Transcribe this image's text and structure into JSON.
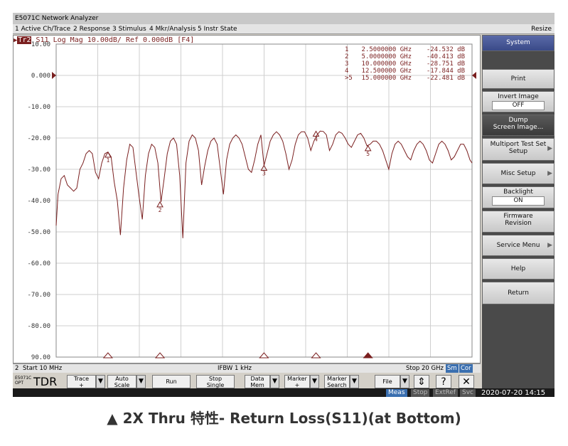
{
  "window": {
    "title": "E5071C Network Analyzer",
    "resize": "Resize"
  },
  "menu": [
    {
      "label": "1 Active Ch/Trace"
    },
    {
      "label": "2 Response"
    },
    {
      "label": "3 Stimulus"
    },
    {
      "label": "4 Mkr/Analysis"
    },
    {
      "label": "5 Instr State"
    }
  ],
  "trace": {
    "tag": "Tr2",
    "header": "S11  Log Mag 10.00dB/ Ref 0.000dB [F4]",
    "color": "#7a1f1f"
  },
  "chart_data": {
    "type": "line",
    "ylim": [
      -90,
      10
    ],
    "xlim": [
      0.01,
      20
    ],
    "x_unit": "GHz",
    "y_unit": "dB",
    "yticks": [
      "10.00",
      "0.000",
      "-10.00",
      "-20.00",
      "-30.00",
      "-40.00",
      "-50.00",
      "-60.00",
      "-70.00",
      "-80.00",
      "90.00"
    ],
    "grid": true,
    "markers": [
      {
        "id": "1",
        "freq": "2.5000000 GHz",
        "value": "-24.532 dB",
        "x": 2.5,
        "y": -24.532
      },
      {
        "id": "2",
        "freq": "5.0000000 GHz",
        "value": "-40.413 dB",
        "x": 5.0,
        "y": -40.413
      },
      {
        "id": "3",
        "freq": "10.000000 GHz",
        "value": "-28.751 dB",
        "x": 10.0,
        "y": -28.751
      },
      {
        "id": "4",
        "freq": "12.500000 GHz",
        "value": "-17.844 dB",
        "x": 12.5,
        "y": -17.844
      },
      {
        "id": "5",
        "freq": "15.000000 GHz",
        "value": "-22.481 dB",
        "x": 15.0,
        "y": -22.481,
        "active": true
      }
    ],
    "series": [
      {
        "x": [
          0.01,
          0.1,
          0.25,
          0.4,
          0.55,
          0.7,
          0.85,
          1.0,
          1.15,
          1.3,
          1.45,
          1.6,
          1.75,
          1.9,
          2.05,
          2.2,
          2.35,
          2.5,
          2.65,
          2.8,
          2.95,
          3.1,
          3.25,
          3.4,
          3.55,
          3.7,
          3.85,
          4.0,
          4.15,
          4.3,
          4.45,
          4.6,
          4.75,
          4.9,
          5.05,
          5.2,
          5.35,
          5.5,
          5.65,
          5.8,
          5.95,
          6.1,
          6.25,
          6.4,
          6.55,
          6.7,
          6.85,
          7.0,
          7.15,
          7.3,
          7.45,
          7.6,
          7.75,
          7.9,
          8.05,
          8.2,
          8.35,
          8.5,
          8.65,
          8.8,
          8.95,
          9.1,
          9.25,
          9.4,
          9.55,
          9.7,
          9.85,
          10.0,
          10.15,
          10.3,
          10.45,
          10.6,
          10.75,
          10.9,
          11.05,
          11.2,
          11.35,
          11.5,
          11.65,
          11.8,
          11.95,
          12.1,
          12.25,
          12.4,
          12.55,
          12.7,
          12.85,
          13.0,
          13.15,
          13.3,
          13.45,
          13.6,
          13.75,
          13.9,
          14.05,
          14.2,
          14.35,
          14.5,
          14.65,
          14.8,
          14.95,
          15.1,
          15.25,
          15.4,
          15.55,
          15.7,
          15.85,
          16.0,
          16.15,
          16.3,
          16.45,
          16.6,
          16.75,
          16.9,
          17.05,
          17.2,
          17.35,
          17.5,
          17.65,
          17.8,
          17.95,
          18.1,
          18.25,
          18.4,
          18.55,
          18.7,
          18.85,
          19.0,
          19.15,
          19.3,
          19.45,
          19.6,
          19.75,
          19.9,
          20.0
        ],
        "y": [
          -48,
          -38,
          -33,
          -32,
          -35,
          -36,
          -37,
          -36,
          -30,
          -28,
          -25,
          -24,
          -25,
          -31,
          -33,
          -28,
          -25,
          -24.5,
          -26,
          -34,
          -40,
          -51,
          -36,
          -27,
          -22,
          -23,
          -31,
          -39,
          -46,
          -32,
          -25,
          -22,
          -23,
          -28,
          -40.4,
          -33,
          -25,
          -21,
          -20,
          -22,
          -32,
          -52,
          -28,
          -21,
          -19,
          -20,
          -24,
          -35,
          -29,
          -24,
          -21,
          -20,
          -22,
          -30,
          -38,
          -27,
          -22,
          -20,
          -19,
          -20,
          -22,
          -26,
          -30,
          -31,
          -27,
          -22,
          -19,
          -28.8,
          -25,
          -21,
          -19,
          -18,
          -19,
          -21,
          -25,
          -30,
          -27,
          -22,
          -19,
          -18,
          -18,
          -20,
          -24,
          -21,
          -19,
          -17.8,
          -17.9,
          -19,
          -24,
          -22,
          -19,
          -18,
          -18.5,
          -20,
          -22,
          -23,
          -21,
          -19,
          -18.5,
          -20,
          -22.5,
          -22,
          -21,
          -21,
          -22,
          -24,
          -27,
          -30,
          -25,
          -22,
          -21,
          -22,
          -24,
          -26,
          -27,
          -24,
          -22,
          -21,
          -22,
          -24,
          -27,
          -28,
          -25,
          -22,
          -21,
          -22,
          -24,
          -27,
          -26,
          -24,
          -22,
          -22,
          -24,
          -27,
          -28
        ]
      }
    ]
  },
  "status": {
    "channel": "2",
    "start": "Start 10 MHz",
    "ifbw": "IFBW 1 kHz",
    "stop": "Stop 20 GHz",
    "chip1": "Sm",
    "chip2": "Cor"
  },
  "bottom": {
    "model_line1": "E5071C",
    "model_line2": "OPT",
    "tdr": "TDR",
    "buttons": [
      {
        "label": "Trace",
        "sub": "+"
      },
      {
        "label": "Auto",
        "sub": "Scale"
      },
      {
        "label": "Run",
        "sub": ""
      },
      {
        "label": "Stop",
        "sub": "Single"
      },
      {
        "label": "Data",
        "sub": "Mem"
      },
      {
        "label": "Marker",
        "sub": "+"
      },
      {
        "label": "Marker",
        "sub": "Search"
      },
      {
        "label": "File",
        "sub": ""
      }
    ],
    "updown": "⇕",
    "help": "?",
    "close": "✕"
  },
  "sysbar": {
    "items": [
      "Meas",
      "Stop",
      "ExtRef",
      "Svc"
    ],
    "datetime": "2020-07-20 14:15"
  },
  "softkeys": {
    "system": "System",
    "print": "Print",
    "invert_label": "Invert Image",
    "invert_value": "OFF",
    "dump_line1": "Dump",
    "dump_line2": "Screen Image...",
    "multiport_line1": "Multiport Test Set",
    "multiport_line2": "Setup",
    "misc": "Misc Setup",
    "backlight_label": "Backlight",
    "backlight_value": "ON",
    "firmware_line1": "Firmware",
    "firmware_line2": "Revision",
    "service": "Service Menu",
    "help": "Help",
    "return": "Return"
  },
  "caption": "▲ 2X Thru 特性- Return Loss(S11)(at Bottom)"
}
